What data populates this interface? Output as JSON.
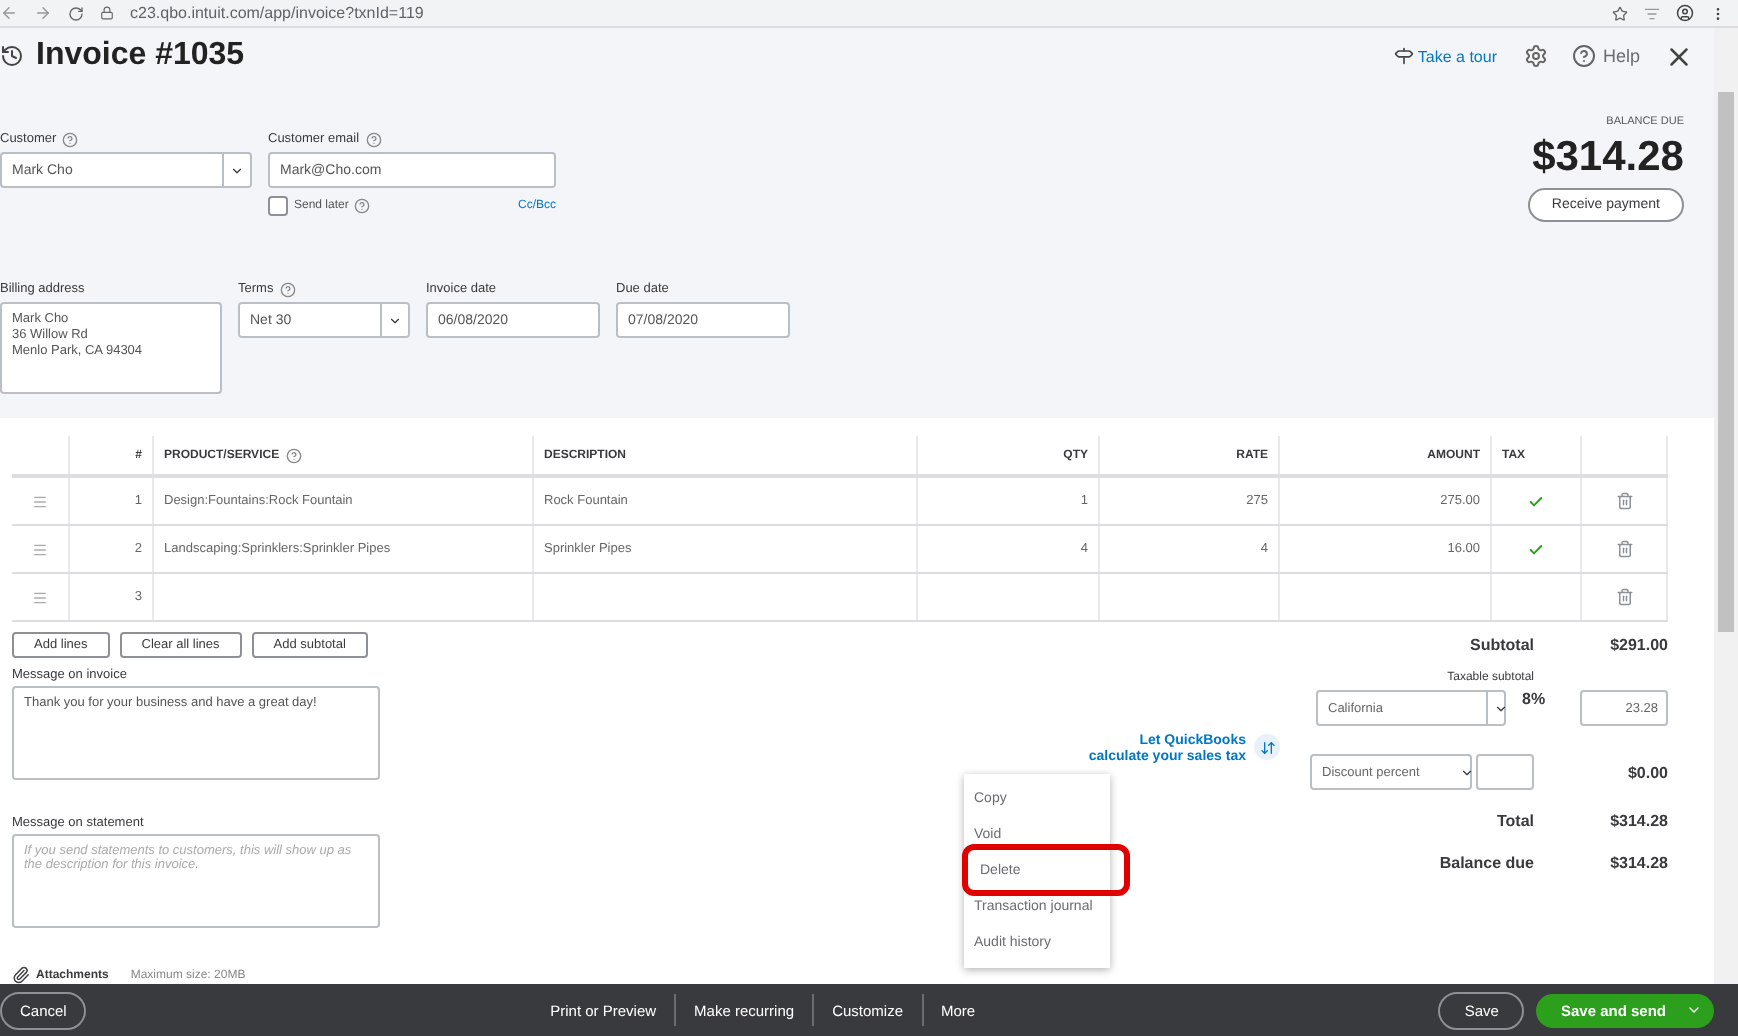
{
  "browser": {
    "url": "c23.qbo.intuit.com/app/invoice?txnId=119"
  },
  "header": {
    "title": "Invoice #1035",
    "tour_link": "Take a tour",
    "help": "Help"
  },
  "customer": {
    "label": "Customer",
    "value": "Mark Cho"
  },
  "customer_email": {
    "label": "Customer email",
    "value": "Mark@Cho.com",
    "send_later": {
      "label": "Send later",
      "checked": false
    },
    "cc_bcc": "Cc/Bcc"
  },
  "balance": {
    "label": "BALANCE DUE",
    "amount": "$314.28",
    "button": "Receive payment"
  },
  "billing_address": {
    "label": "Billing address",
    "lines": [
      "Mark Cho",
      "36 Willow Rd",
      "Menlo Park, CA  94304"
    ]
  },
  "terms": {
    "label": "Terms",
    "value": "Net 30"
  },
  "invoice_date": {
    "label": "Invoice date",
    "value": "06/08/2020"
  },
  "due_date": {
    "label": "Due date",
    "value": "07/08/2020"
  },
  "table": {
    "columns": [
      "#",
      "PRODUCT/SERVICE",
      "DESCRIPTION",
      "QTY",
      "RATE",
      "AMOUNT",
      "TAX"
    ],
    "rows": [
      {
        "number": "1",
        "product": "Design:Fountains:Rock Fountain",
        "description": "Rock Fountain",
        "qty": "1",
        "rate": "275",
        "amount": "275.00",
        "taxable": true
      },
      {
        "number": "2",
        "product": "Landscaping:Sprinklers:Sprinkler Pipes",
        "description": "Sprinkler Pipes",
        "qty": "4",
        "rate": "4",
        "amount": "16.00",
        "taxable": true
      },
      {
        "number": "3",
        "taxable": false
      }
    ]
  },
  "line_buttons": [
    "Add lines",
    "Clear all lines",
    "Add subtotal"
  ],
  "subtotal": {
    "label": "Subtotal",
    "value": "$291.00"
  },
  "taxable_subtotal": "Taxable subtotal",
  "sales_tax": {
    "prompt_lines": [
      "Let QuickBooks",
      "calculate your sales tax"
    ],
    "rate_select": "California",
    "rate": "8%",
    "tax_amount": "23.28"
  },
  "discount": {
    "type": "Discount percent",
    "value": "$0.00"
  },
  "total": {
    "label": "Total",
    "value": "$314.28"
  },
  "balance_due": {
    "label": "Balance due",
    "value": "$314.28"
  },
  "message_invoice": {
    "label": "Message on invoice",
    "value": "Thank you for your business and have a great day!"
  },
  "message_statement": {
    "label": "Message on statement",
    "placeholder": "If you send statements to customers, this will show up as the description for this invoice."
  },
  "attachments": {
    "label": "Attachments",
    "note": "Maximum size: 20MB"
  },
  "footer": {
    "cancel": "Cancel",
    "actions": [
      "Print or Preview",
      "Make recurring",
      "Customize",
      "More"
    ],
    "save": "Save",
    "save_and_send": "Save and send"
  },
  "more_menu": [
    {
      "label": "Copy",
      "highlighted": false
    },
    {
      "label": "Void",
      "highlighted": false
    },
    {
      "label": "Delete",
      "highlighted": true
    },
    {
      "label": "Transaction journal",
      "highlighted": false
    },
    {
      "label": "Audit history",
      "highlighted": false
    }
  ]
}
